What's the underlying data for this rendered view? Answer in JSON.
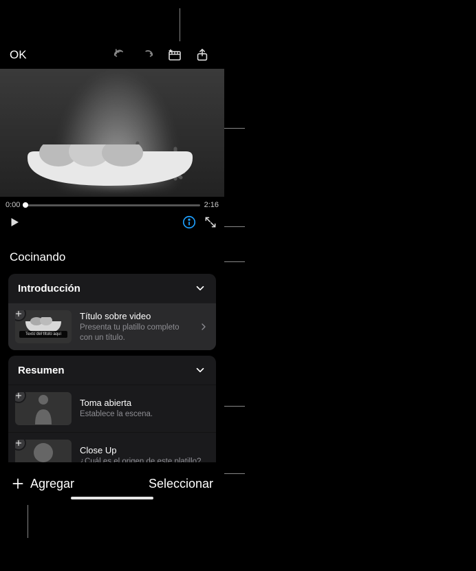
{
  "toolbar": {
    "ok_label": "OK"
  },
  "scrubber": {
    "current_time": "0:00",
    "duration": "2:16"
  },
  "project": {
    "title": "Cocinando"
  },
  "sections": [
    {
      "title": "Introducción",
      "shots": [
        {
          "title": "Título sobre video",
          "desc": "Presenta tu platillo completo con un título.",
          "thumb_placeholder": "Texto del título aquí"
        }
      ]
    },
    {
      "title": "Resumen",
      "shots": [
        {
          "title": "Toma abierta",
          "desc": "Establece la escena."
        },
        {
          "title": "Close Up",
          "desc": "¿Cuál es el origen de este platillo?"
        }
      ]
    }
  ],
  "bottombar": {
    "add_label": "Agregar",
    "select_label": "Seleccionar"
  },
  "colors": {
    "accent": "#1ea0ff"
  }
}
